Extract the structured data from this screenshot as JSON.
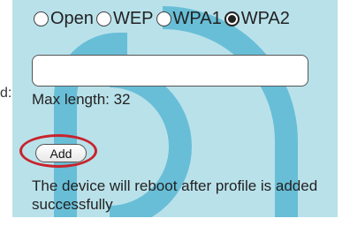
{
  "security": {
    "options": [
      {
        "label": "Open",
        "checked": false
      },
      {
        "label": "WEP",
        "checked": false
      },
      {
        "label": "WPA1",
        "checked": false
      },
      {
        "label": "WPA2",
        "checked": true
      }
    ]
  },
  "password": {
    "cut_label": "d:",
    "value": "",
    "max_length_text": "Max length: 32"
  },
  "add_button": {
    "label": "Add",
    "highlight_color": "#c8232c"
  },
  "note": {
    "text": "The device will reboot after profile is added successfully"
  },
  "colors": {
    "panel_bg": "#b9e1ea",
    "logo": "#5bb9d4"
  }
}
